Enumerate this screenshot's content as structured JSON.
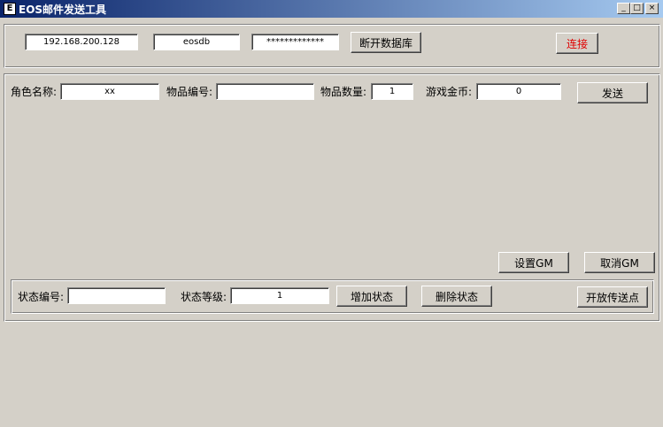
{
  "window": {
    "title": "EOS邮件发送工具",
    "icon_glyph": "E",
    "minimize_glyph": "_",
    "maximize_glyph": "□",
    "close_glyph": "×"
  },
  "connection": {
    "host": "192.168.200.128",
    "database": "eosdb",
    "password_mask": "*************",
    "disconnect_label": "断开数据库",
    "connect_label": "连接",
    "connect_color": "#e00000"
  },
  "mail": {
    "role_name_label": "角色名称:",
    "role_name_value": "xx",
    "item_id_label": "物品编号:",
    "item_id_value": "",
    "item_qty_label": "物品数量:",
    "item_qty_value": "1",
    "gold_label": "游戏金币:",
    "gold_value": "0",
    "send_label": "发送"
  },
  "gm": {
    "set_label": "设置GM",
    "cancel_label": "取消GM"
  },
  "status": {
    "id_label": "状态编号:",
    "id_value": "",
    "level_label": "状态等级:",
    "level_value": "1",
    "add_label": "增加状态",
    "remove_label": "删除状态",
    "open_teleport_label": "开放传送点"
  }
}
